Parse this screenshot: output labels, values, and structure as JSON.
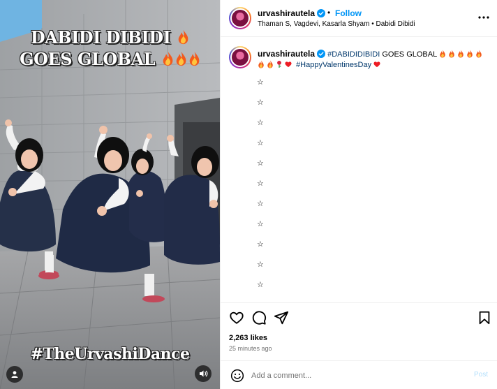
{
  "media": {
    "overlay_line1": "DABIDI DIBIDI",
    "overlay_line2": "GOES GLOBAL",
    "overlay_hashtag": "#TheUrvashiDance",
    "icons": [
      "user-tag-icon",
      "sound-icon",
      "fire-emoji"
    ]
  },
  "header": {
    "username": "urvashirautela",
    "separator": "•",
    "follow_label": "Follow",
    "audio_credit": "Thaman S, Vagdevi, Kasarla Shyam • Dabidi Dibidi",
    "icons": [
      "verified-badge-icon",
      "more-options-icon"
    ]
  },
  "caption": {
    "username": "urvashirautela",
    "hashtag_main": "#DABIDIDIBIDI",
    "text_main": " GOES GLOBAL ",
    "hashtag_valentines": "#HappyValentinesDay",
    "star_lines": [
      "☆",
      "☆",
      "☆",
      "☆",
      "☆",
      "☆",
      "☆",
      "☆",
      "☆",
      "☆",
      "☆"
    ],
    "emoji_names": [
      "fire-emoji",
      "fire-emoji",
      "fire-emoji",
      "fire-emoji",
      "fire-emoji",
      "fire-emoji",
      "fire-emoji",
      "rose-emoji",
      "heart-emoji",
      "heart-emoji"
    ]
  },
  "actions": {
    "likes": "2,263 likes",
    "timestamp": "25 minutes ago",
    "icons": [
      "like-icon",
      "comment-icon",
      "share-icon",
      "save-icon"
    ]
  },
  "comment_bar": {
    "placeholder": "Add a comment...",
    "post_label": "Post",
    "icons": [
      "emoji-icon"
    ]
  },
  "colors": {
    "link_blue": "#0095f6",
    "hashtag_blue": "#00376b",
    "muted_gray": "#737373",
    "post_disabled": "#b2dffc",
    "heart_red": "#ed1c24"
  }
}
